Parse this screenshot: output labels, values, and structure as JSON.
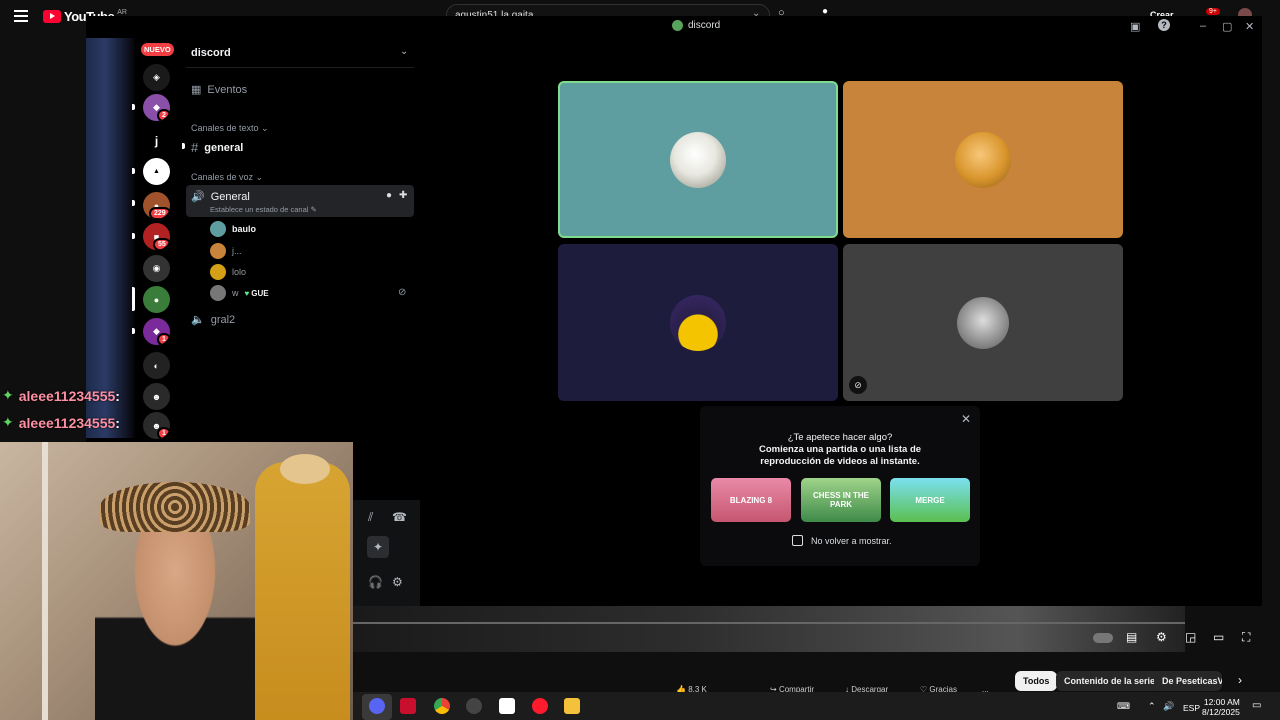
{
  "youtube": {
    "logo_text": "YouTube",
    "region": "AR",
    "search_value": "agustin51 la gaita",
    "create_label": "Crear",
    "notif_count": "9+",
    "actions": {
      "likes": "8.3 K",
      "share": "Compartir",
      "download": "Descargar",
      "thanks": "Gracias",
      "more": "..."
    },
    "chips": [
      "Todos",
      "Contenido de la serie",
      "De PeseticasVF"
    ]
  },
  "discord": {
    "window_title": "discord",
    "server_name": "discord",
    "events_label": "Eventos",
    "new_badge": "NUEVO",
    "text_category": "Canales de texto",
    "text_channels": [
      "general"
    ],
    "voice_category": "Canales de voz",
    "voice_channel": "General",
    "voice_status": "Establece un estado de canal",
    "voice_users": [
      {
        "name": "baulo"
      },
      {
        "name": "j..."
      },
      {
        "name": "lolo"
      },
      {
        "name": "w",
        "tag": "GUE"
      }
    ],
    "voice_channel_2": "gral2",
    "server_badges": [
      "2",
      "229",
      "55",
      "1",
      "1"
    ],
    "server_letter": "j",
    "activity": {
      "question": "¿Te apetece hacer algo?",
      "body": "Comienza una partida o una lista de reproducción de videos al instante.",
      "games": [
        "BLAZING 8",
        "CHESS IN THE PARK",
        "MERGE"
      ],
      "dont_show": "No volver a mostrar."
    }
  },
  "chat_overlay": [
    {
      "user": "aleee11234555",
      "sep": ":"
    },
    {
      "user": "aleee11234555",
      "sep": ":"
    }
  ],
  "taskbar": {
    "lang": "ESP",
    "time": "12:00 AM",
    "date": "8/12/2025"
  },
  "colors": {
    "discord_bg": "#000000",
    "tile_1": "#5f9ea0",
    "tile_2": "#c8843a",
    "tile_3": "#1e1c3d",
    "tile_4": "#404040",
    "speaking_border": "#7fdc8a",
    "badge_red": "#f23f43",
    "chat_name": "#ff8fa3"
  }
}
